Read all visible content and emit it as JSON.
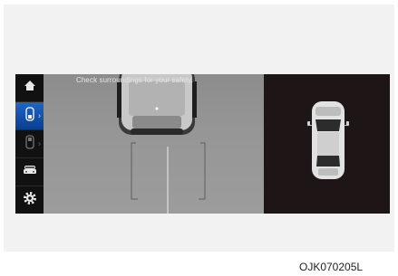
{
  "screen": {
    "warning_text": "Check surroundings for your safety.",
    "sidebar": [
      {
        "icon": "home-icon",
        "active": false
      },
      {
        "icon": "rear-view-camera-icon",
        "active": true
      },
      {
        "icon": "front-view-camera-icon",
        "active": false
      },
      {
        "icon": "vehicle-view-icon",
        "active": false
      },
      {
        "icon": "settings-gear-icon",
        "active": false
      }
    ],
    "colors": {
      "active_button": "#1e66c8",
      "screen_background": "#000000",
      "camera_view": "#969696",
      "top_view_background": "#1e1616"
    }
  },
  "figure_code": "OJK070205L"
}
